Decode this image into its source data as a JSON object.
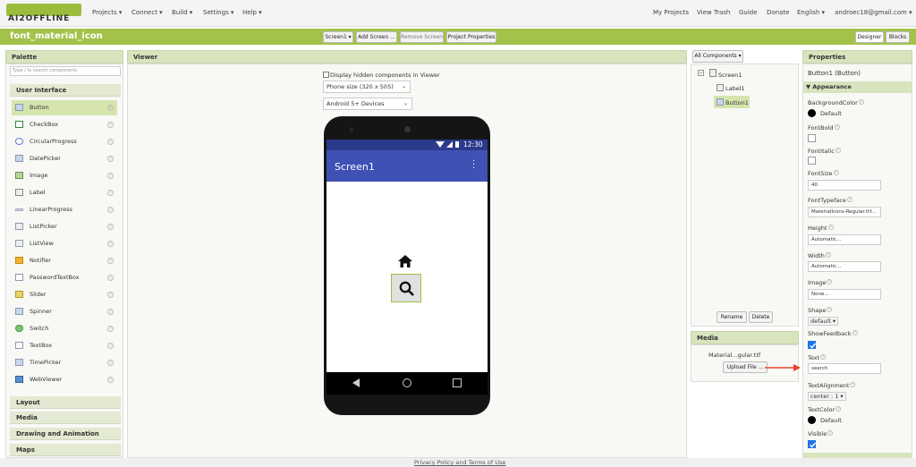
{
  "app": {
    "logo_text": "AI2OFFLINE",
    "project_title": "font_material_icon"
  },
  "nav_left": [
    "Projects ▾",
    "Connect ▾",
    "Build ▾",
    "Settings ▾",
    "Help ▾"
  ],
  "nav_right": [
    "My Projects",
    "View Trash",
    "Guide",
    "Donate",
    "English ▾",
    "androec18@gmail.com ▾"
  ],
  "toolbar": {
    "screen_select": "Screen1 ▾",
    "add_screen": "Add Screen ...",
    "remove_screen": "Remove Screen",
    "project_properties": "Project Properties",
    "designer": "Designer",
    "blocks": "Blocks"
  },
  "palette": {
    "header": "Palette",
    "search_placeholder": "Type / to search components",
    "sections": [
      "User Interface",
      "Layout",
      "Media",
      "Drawing and Animation",
      "Maps"
    ],
    "items": [
      "Button",
      "CheckBox",
      "CircularProgress",
      "DatePicker",
      "Image",
      "Label",
      "LinearProgress",
      "ListPicker",
      "ListView",
      "Notifier",
      "PasswordTextBox",
      "Slider",
      "Spinner",
      "Switch",
      "TextBox",
      "TimePicker",
      "WebViewer"
    ],
    "help_glyph": "?"
  },
  "viewer": {
    "header": "Viewer",
    "display_hidden": "Display hidden components in Viewer",
    "phone_size": "Phone size (320 x 505)",
    "android_version": "Android 5+ Devices",
    "status_time": "12:30",
    "screen_title": "Screen1",
    "label_icon": "home-icon",
    "button_icon": "search-icon"
  },
  "components": {
    "header": "All Components ▾",
    "tree": [
      "Screen1",
      "Label1",
      "Button1"
    ],
    "rename": "Rename",
    "delete": "Delete"
  },
  "media": {
    "header": "Media",
    "file": "Material...gular.ttf",
    "upload": "Upload File ..."
  },
  "properties": {
    "header": "Properties",
    "component": "Button1 (Button)",
    "group": "Appearance",
    "background_color_label": "BackgroundColor",
    "background_color_value": "Default",
    "font_bold_label": "FontBold",
    "font_italic_label": "FontItalic",
    "font_size_label": "FontSize",
    "font_size_value": "40",
    "font_typeface_label": "FontTypeface",
    "font_typeface_value": "MaterialIcons-Regular.ttf...",
    "height_label": "Height",
    "height_value": "Automatic...",
    "width_label": "Width",
    "width_value": "Automatic...",
    "image_label": "Image",
    "image_value": "None...",
    "shape_label": "Shape",
    "shape_value": "default ▾",
    "show_feedback_label": "ShowFeedback",
    "show_feedback_checked": true,
    "text_label": "Text",
    "text_value": "search",
    "text_alignment_label": "TextAlignment",
    "text_alignment_value": "center : 1 ▾",
    "text_color_label": "TextColor",
    "text_color_value": "Default",
    "visible_label": "Visible",
    "visible_checked": true
  },
  "footer": {
    "link": "Privacy Policy and Terms of Use"
  },
  "colors": {
    "brand_green": "#a3c24a",
    "app_bar": "#3f51b5",
    "status_bar": "#2c3a8c",
    "annotation_arrow": "#e8442c",
    "checkbox_blue": "#1e73e8"
  }
}
